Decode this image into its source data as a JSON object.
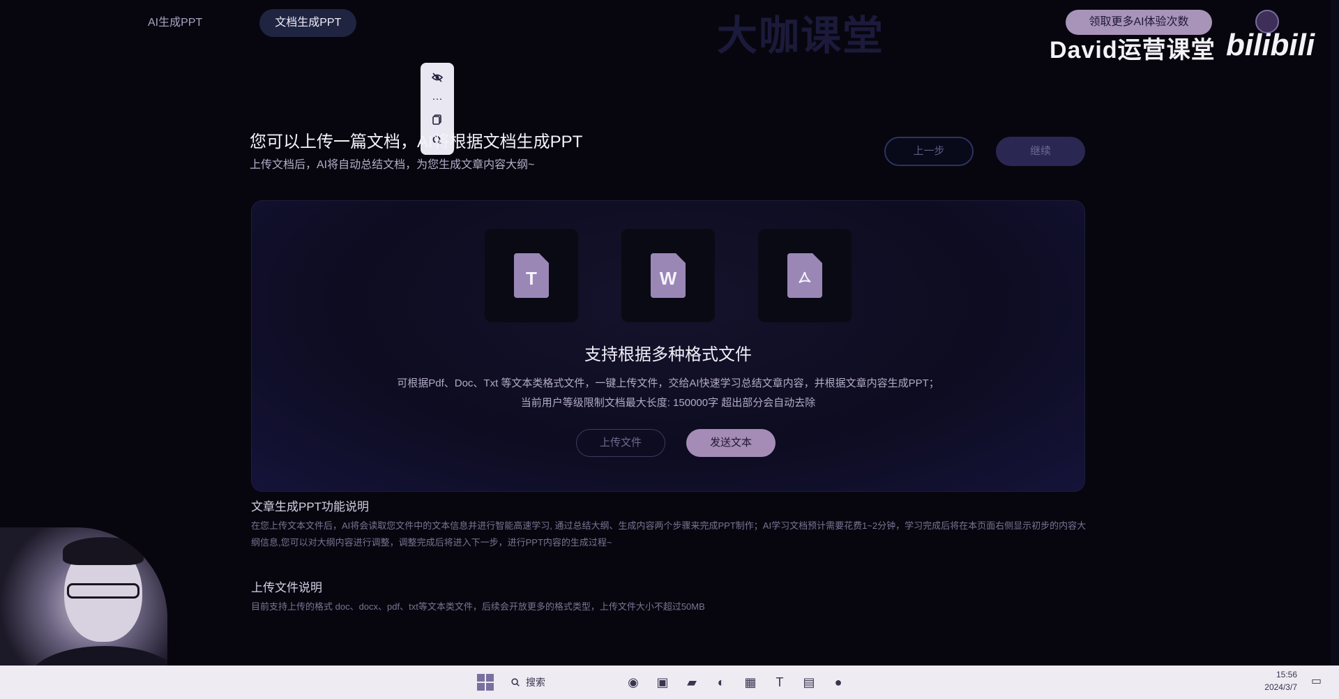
{
  "nav": {
    "tabs": [
      {
        "label": "AI生成PPT",
        "active": false
      },
      {
        "label": "文档生成PPT",
        "active": true
      }
    ]
  },
  "brand": {
    "title": "大咖课堂",
    "promo_button": "领取更多AI体验次数",
    "watermark_author": "David运营课堂",
    "watermark_logo": "bilibili"
  },
  "float_toolbar": {
    "items": [
      "eye-off-icon",
      "more-icon",
      "copy-icon",
      "search-icon"
    ]
  },
  "header": {
    "title": "您可以上传一篇文档，AI将根据文档生成PPT",
    "subtitle": "上传文档后，AI将自动总结文档，为您生成文章内容大纲~",
    "prev_button": "上一步",
    "next_button": "继续"
  },
  "upload": {
    "file_types": [
      "T",
      "W",
      "PDF"
    ],
    "heading": "支持根据多种格式文件",
    "description": "可根据Pdf、Doc、Txt 等文本类格式文件，一键上传文件，交给AI快速学习总结文章内容，并根据文章内容生成PPT；",
    "limit": "当前用户等级限制文档最大长度: 150000字 超出部分会自动去除",
    "upload_button": "上传文件",
    "send_button": "发送文本"
  },
  "info": {
    "feature_title": "文章生成PPT功能说明",
    "feature_text": "在您上传文本文件后，AI将会读取您文件中的文本信息并进行智能高速学习, 通过总结大纲、生成内容两个步骤来完成PPT制作；AI学习文档预计需要花费1~2分钟，学习完成后将在本页面右侧显示初步的内容大纲信息,您可以对大纲内容进行调整，调整完成后将进入下一步，进行PPT内容的生成过程~",
    "upload_title": "上传文件说明",
    "upload_text": "目前支持上传的格式 doc、docx、pdf、txt等文本类文件，后续会开放更多的格式类型，上传文件大小不超过50MB"
  },
  "taskbar": {
    "search_label": "搜索",
    "time": "15:56",
    "date": "2024/3/7"
  },
  "colors": {
    "background": "#07060f",
    "accent": "#a58cb6",
    "tab_active": "#1f2440"
  }
}
